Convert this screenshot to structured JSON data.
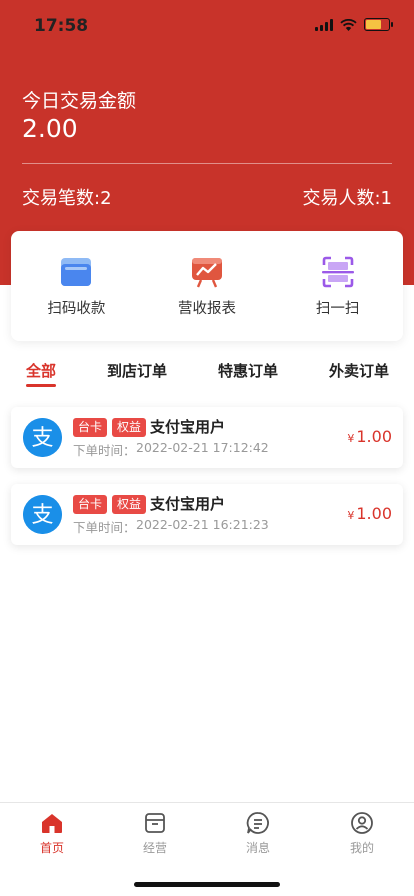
{
  "status_bar": {
    "time": "17:58"
  },
  "summary": {
    "today_label": "今日交易金额",
    "today_amount": "2.00",
    "count_label": "交易笔数:2",
    "people_label": "交易人数:1"
  },
  "quick_actions": [
    {
      "label": "扫码收款",
      "icon": "payment-folder-icon"
    },
    {
      "label": "营收报表",
      "icon": "report-chart-icon"
    },
    {
      "label": "扫一扫",
      "icon": "scan-icon"
    }
  ],
  "tabs": [
    {
      "label": "全部",
      "active": true
    },
    {
      "label": "到店订单",
      "active": false
    },
    {
      "label": "特惠订单",
      "active": false
    },
    {
      "label": "外卖订单",
      "active": false
    }
  ],
  "orders": [
    {
      "badge1": "台卡",
      "badge2": "权益",
      "user": "支付宝用户",
      "time_label": "下单时间：",
      "time": "2022-02-21 17:12:42",
      "currency": "¥",
      "amount": "1.00"
    },
    {
      "badge1": "台卡",
      "badge2": "权益",
      "user": "支付宝用户",
      "time_label": "下单时间：",
      "time": "2022-02-21 16:21:23",
      "currency": "¥",
      "amount": "1.00"
    }
  ],
  "bottom_nav": [
    {
      "label": "首页",
      "icon": "home-icon",
      "active": true
    },
    {
      "label": "经营",
      "icon": "box-icon",
      "active": false
    },
    {
      "label": "消息",
      "icon": "message-icon",
      "active": false
    },
    {
      "label": "我的",
      "icon": "profile-icon",
      "active": false
    }
  ],
  "colors": {
    "brand": "#c8332a",
    "accent": "#d9342b",
    "alipay": "#1a8fe8"
  }
}
